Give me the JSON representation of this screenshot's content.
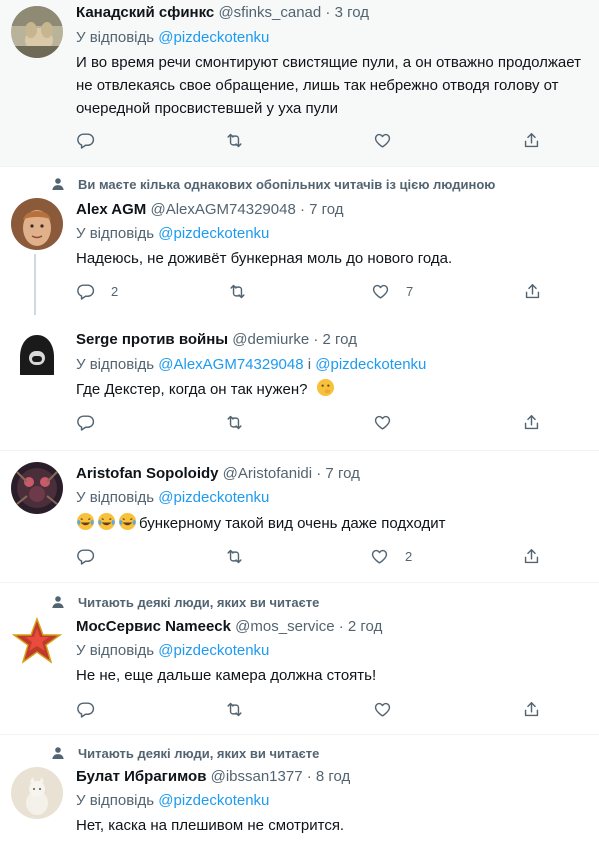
{
  "tweets": [
    {
      "name": "Канадский сфинкс",
      "handle": "@sfinks_canad · 3 год",
      "reply_prefix": "У відповідь",
      "reply_to": "@pizdeckotenku",
      "text": "И во время речи смонтируют свистящие пули, а он отважно продолжает не отвлекаясь свое обращение, лишь так небрежно отводя голову от очередной просвистевшей у уха пули",
      "replies": "",
      "retweets": "",
      "likes": ""
    },
    {
      "social_context": "Ви маєте кілька однакових обопільних читачів із цією людиною",
      "name": "Alex AGM",
      "handle": "@AlexAGM74329048 · 7 год",
      "reply_prefix": "У відповідь",
      "reply_to": "@pizdeckotenku",
      "text": "Надеюсь, не доживёт бункерная моль до нового года.",
      "replies": "2",
      "retweets": "",
      "likes": "7"
    },
    {
      "name": "Serge против войны",
      "handle": "@demiurke · 2 год",
      "reply_prefix": "У відповідь",
      "reply_to": "@AlexAGM74329048",
      "reply_joiner": "і",
      "reply_to_2": "@pizdeckotenku",
      "text": "Где Декстер, когда он так нужен?",
      "replies": "",
      "retweets": "",
      "likes": ""
    },
    {
      "name": "Aristofan Sopoloidy",
      "handle": "@Aristofanidi · 7 год",
      "reply_prefix": "У відповідь",
      "reply_to": "@pizdeckotenku",
      "text": "бункерному такой вид очень даже подходит",
      "replies": "",
      "retweets": "",
      "likes": "2"
    },
    {
      "social_context": "Читають деякі люди, яких ви читаєте",
      "name": "МосСервис Nameeck",
      "handle": "@mos_service · 2 год",
      "reply_prefix": "У відповідь",
      "reply_to": "@pizdeckotenku",
      "text": "Не не, еще дальше камера должна стоять!",
      "replies": "",
      "retweets": "",
      "likes": ""
    },
    {
      "social_context": "Читають деякі люди, яких ви читаєте",
      "name": "Булат Ибрагимов",
      "handle": "@ibssan1377 · 8 год",
      "reply_prefix": "У відповідь",
      "reply_to": "@pizdeckotenku",
      "text": "Нет, каска на плешивом не смотрится."
    }
  ],
  "colors": {
    "link": "#1d9bf0",
    "secondary": "#536471",
    "text": "#0f1419",
    "divider": "#eff3f4"
  }
}
